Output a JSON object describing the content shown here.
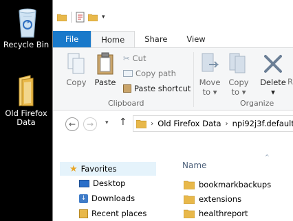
{
  "desktop": {
    "recycle_bin_label": "Recycle Bin",
    "folder_label_line1": "Old Firefox",
    "folder_label_line2": "Data"
  },
  "ribbon_tabs": {
    "file": "File",
    "home": "Home",
    "share": "Share",
    "view": "View"
  },
  "clipboard": {
    "copy": "Copy",
    "paste": "Paste",
    "cut": "Cut",
    "copy_path": "Copy path",
    "paste_shortcut": "Paste shortcut",
    "group_label": "Clipboard"
  },
  "organize": {
    "move_to": "Move",
    "move_to_line2": "to",
    "copy_to": "Copy",
    "copy_to_line2": "to",
    "delete": "Delete",
    "rename_partial": "R",
    "group_label": "Organize"
  },
  "address": {
    "segment1": "Old Firefox Data",
    "segment2": "npi92j3f.default-"
  },
  "navpane": {
    "favorites": "Favorites",
    "desktop": "Desktop",
    "downloads": "Downloads",
    "recent": "Recent places"
  },
  "content": {
    "column_name": "Name",
    "files": [
      "bookmarkbackups",
      "extensions",
      "healthreport"
    ]
  },
  "colors": {
    "file_tab": "#1979ca",
    "ribbon_bg": "#f5f6f7",
    "folder": "#e8b84a",
    "selected": "#e5f3fb"
  }
}
